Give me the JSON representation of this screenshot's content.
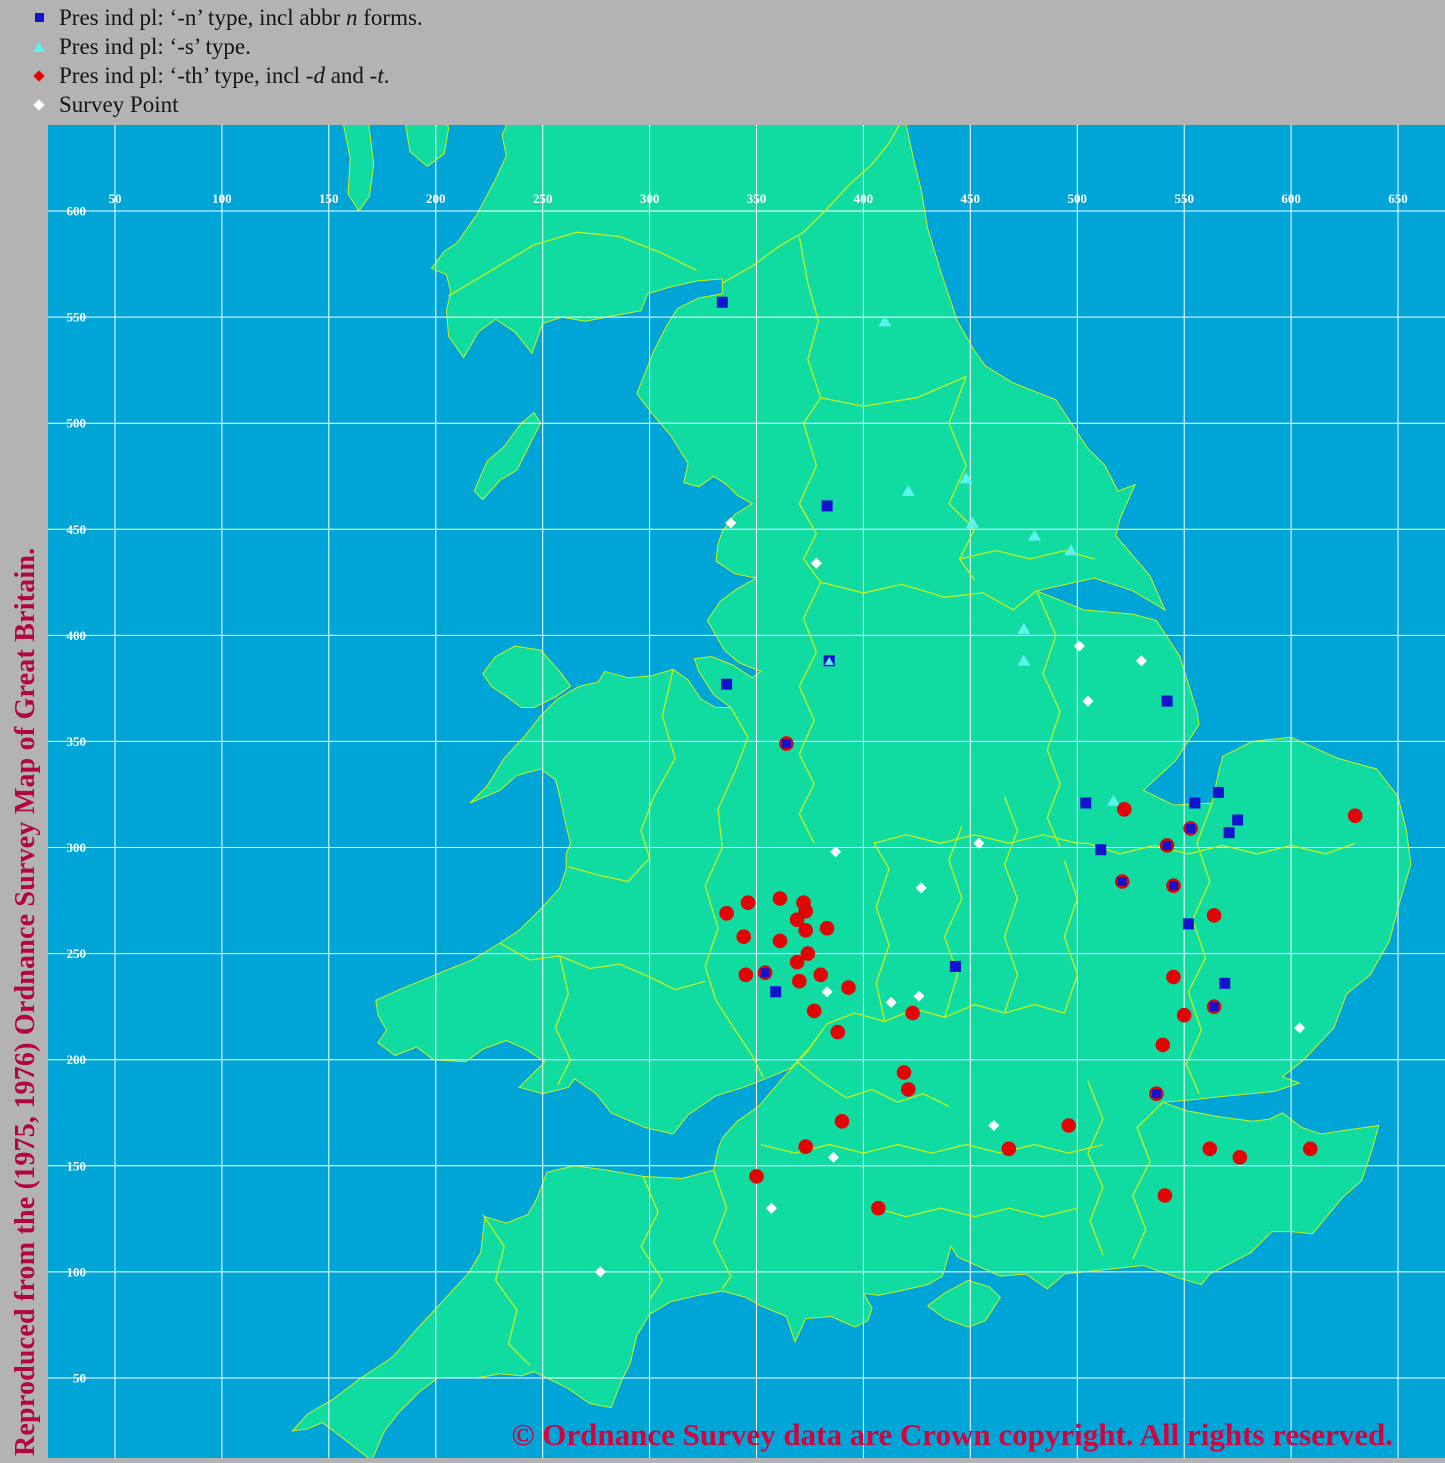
{
  "legend": {
    "items": [
      {
        "marker": "blue-square",
        "name": "legend-item-n-type",
        "segments": [
          {
            "t": "Pres ind pl: ‘-n’ type, incl abbr ",
            "i": false
          },
          {
            "t": "n",
            "i": true
          },
          {
            "t": " forms.",
            "i": false
          }
        ]
      },
      {
        "marker": "cyan-triangle",
        "name": "legend-item-s-type",
        "segments": [
          {
            "t": "Pres ind pl: ‘-s’ type.",
            "i": false
          }
        ]
      },
      {
        "marker": "red-diamond",
        "name": "legend-item-th-type",
        "segments": [
          {
            "t": "Pres ind pl: ‘-th’ type, incl ",
            "i": false
          },
          {
            "t": "-d",
            "i": true
          },
          {
            "t": " and ",
            "i": false
          },
          {
            "t": "-t",
            "i": true
          },
          {
            "t": ".",
            "i": false
          }
        ]
      },
      {
        "marker": "white-diamond",
        "name": "legend-item-survey-point",
        "segments": [
          {
            "t": "Survey Point",
            "i": false
          }
        ]
      }
    ]
  },
  "map": {
    "side_caption": "Reproduced from the (1975, 1976) Ordnance Survey Map of Great Britain.",
    "copyright": "© Ordnance Survey data are Crown copyright. All rights reserved.",
    "x_ticks": [
      50,
      100,
      150,
      200,
      250,
      300,
      350,
      400,
      450,
      500,
      550,
      600,
      650
    ],
    "y_ticks": [
      600,
      550,
      500,
      450,
      400,
      350,
      300,
      250,
      200,
      150,
      100,
      50
    ]
  },
  "colors": {
    "legend_bg": "#b3b3b3",
    "sea": "#00a5d8",
    "land": "#10dca2",
    "boundary": "#c9f116",
    "grid": "#ffffff",
    "n_type": "#1212cf",
    "s_type": "#5ef2ee",
    "th_type": "#e20505",
    "survey": "#ffffff",
    "side_caption": "#b30540",
    "copyright": "#d10440",
    "tick_label": "#ffffff"
  },
  "markers": {
    "n_type": [
      [
        334,
        557
      ],
      [
        383,
        461
      ],
      [
        336,
        377
      ],
      [
        504,
        321
      ],
      [
        555,
        321
      ],
      [
        566,
        326
      ],
      [
        575,
        313
      ],
      [
        571,
        307
      ],
      [
        511,
        299
      ],
      [
        552,
        264
      ],
      [
        542,
        369
      ],
      [
        443,
        244
      ],
      [
        359,
        232
      ],
      [
        569,
        236
      ]
    ],
    "s_type": [
      [
        410,
        548
      ],
      [
        421,
        468
      ],
      [
        448,
        474
      ],
      [
        451,
        453
      ],
      [
        480,
        447
      ],
      [
        497,
        440
      ],
      [
        475,
        403
      ],
      [
        475,
        388
      ],
      [
        517,
        322
      ]
    ],
    "th_type": [
      [
        336,
        269
      ],
      [
        346,
        274
      ],
      [
        361,
        276
      ],
      [
        372,
        274
      ],
      [
        373,
        270
      ],
      [
        369,
        266
      ],
      [
        344,
        258
      ],
      [
        361,
        256
      ],
      [
        373,
        261
      ],
      [
        383,
        262
      ],
      [
        374,
        250
      ],
      [
        369,
        246
      ],
      [
        345,
        240
      ],
      [
        370,
        237
      ],
      [
        380,
        240
      ],
      [
        393,
        234
      ],
      [
        377,
        223
      ],
      [
        388,
        213
      ],
      [
        423,
        222
      ],
      [
        419,
        194
      ],
      [
        421,
        186
      ],
      [
        390,
        171
      ],
      [
        373,
        159
      ],
      [
        350,
        145
      ],
      [
        407,
        130
      ],
      [
        496,
        169
      ],
      [
        468,
        158
      ],
      [
        522,
        318
      ],
      [
        564,
        268
      ],
      [
        545,
        239
      ],
      [
        550,
        221
      ],
      [
        540,
        207
      ],
      [
        562,
        158
      ],
      [
        576,
        154
      ],
      [
        609,
        158
      ],
      [
        541,
        136
      ],
      [
        630,
        315
      ]
    ],
    "survey": [
      [
        338,
        453
      ],
      [
        378,
        434
      ],
      [
        501,
        395
      ],
      [
        530,
        388
      ],
      [
        505,
        369
      ],
      [
        387,
        298
      ],
      [
        454,
        302
      ],
      [
        427,
        281
      ],
      [
        383,
        232
      ],
      [
        413,
        227
      ],
      [
        426,
        230
      ],
      [
        461,
        169
      ],
      [
        386,
        154
      ],
      [
        357,
        130
      ],
      [
        277,
        100
      ],
      [
        604,
        215
      ]
    ],
    "n_th_overlap": [
      [
        364,
        349
      ],
      [
        354,
        241
      ],
      [
        521,
        284
      ],
      [
        545,
        282
      ],
      [
        542,
        301
      ],
      [
        564,
        225
      ],
      [
        537,
        184
      ],
      [
        553,
        309
      ]
    ],
    "n_s_overlap": [
      [
        384,
        388
      ]
    ]
  }
}
